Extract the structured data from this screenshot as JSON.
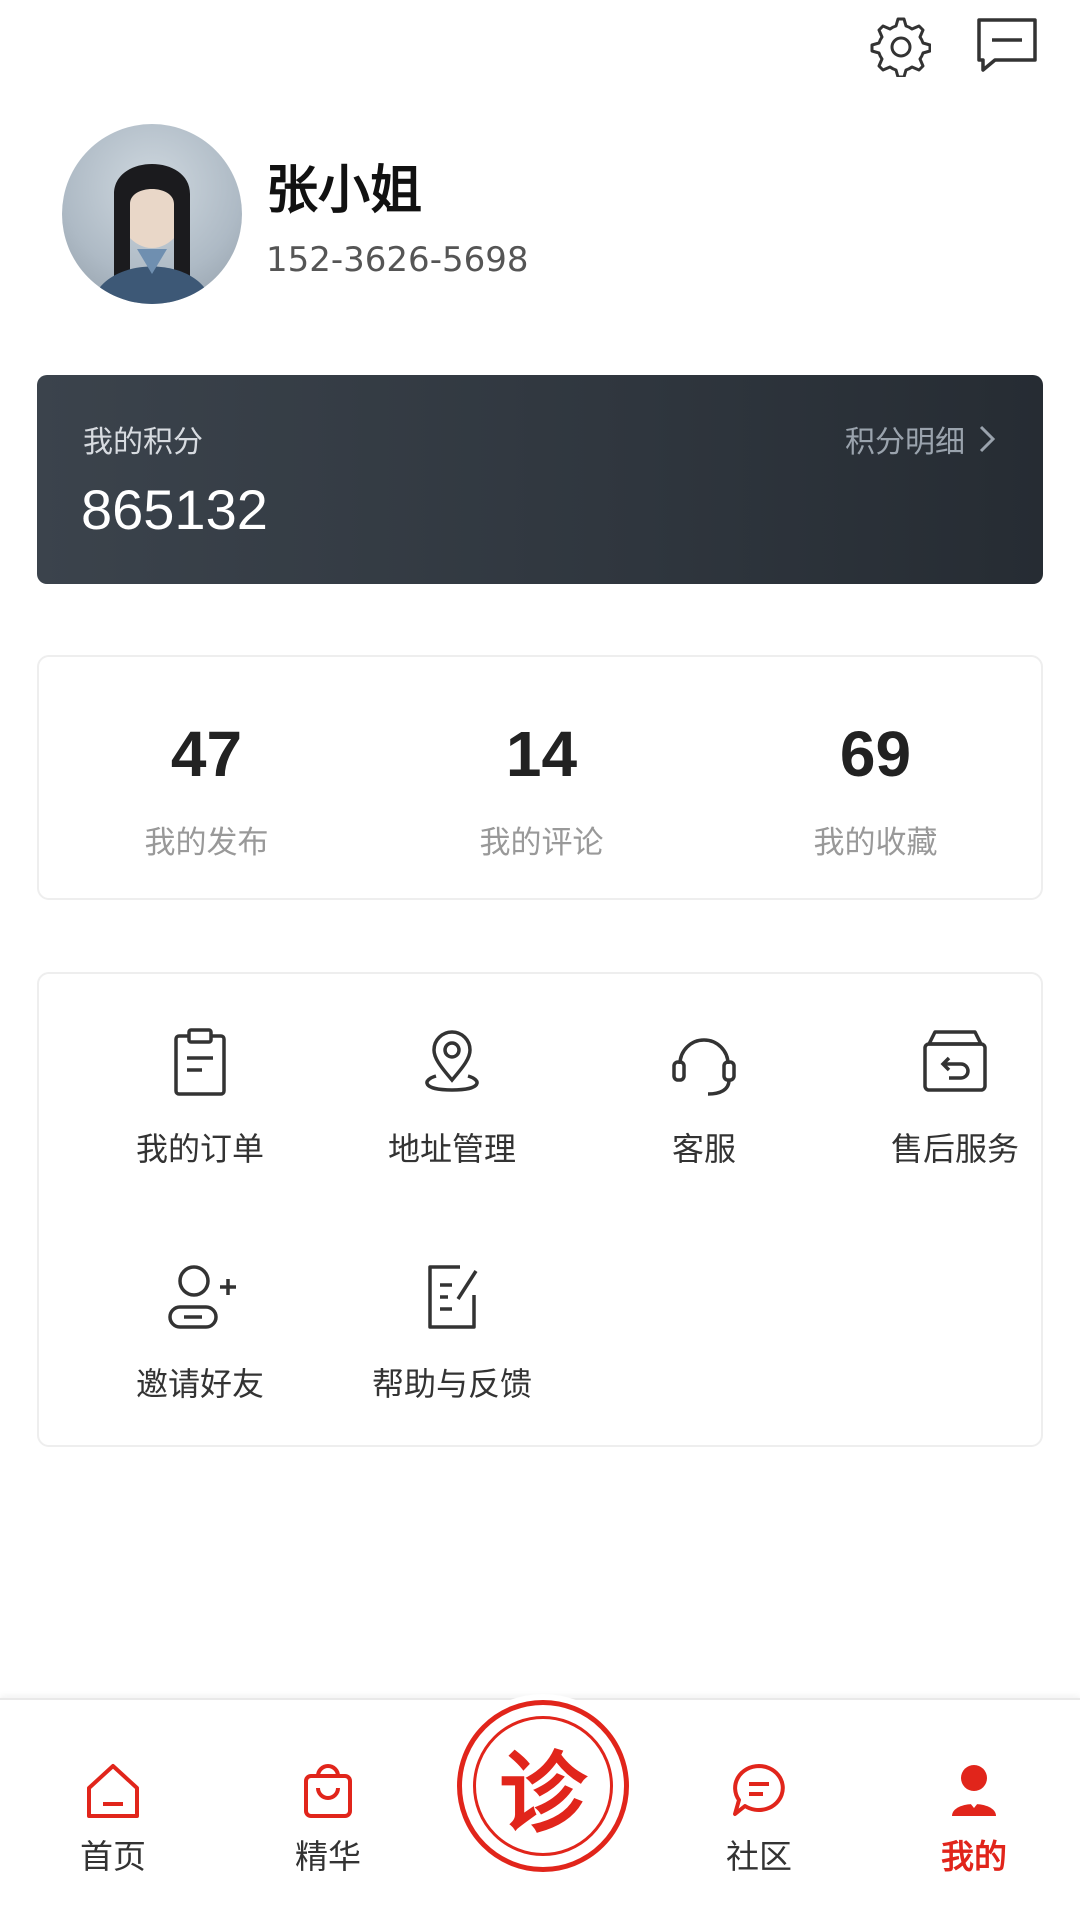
{
  "accent_color": "#e1251b",
  "header_icons": [
    "gear-icon",
    "message-icon"
  ],
  "profile": {
    "name": "张小姐",
    "phone": "152-3626-5698"
  },
  "points": {
    "label": "我的积分",
    "value": "865132",
    "detail_link": "积分明细"
  },
  "stats": [
    {
      "value": "47",
      "label": "我的发布"
    },
    {
      "value": "14",
      "label": "我的评论"
    },
    {
      "value": "69",
      "label": "我的收藏"
    }
  ],
  "services": [
    {
      "icon": "clipboard-icon",
      "label": "我的订单"
    },
    {
      "icon": "location-pin-icon",
      "label": "地址管理"
    },
    {
      "icon": "headset-icon",
      "label": "客服"
    },
    {
      "icon": "return-box-icon",
      "label": "售后服务"
    },
    {
      "icon": "add-user-icon",
      "label": "邀请好友"
    },
    {
      "icon": "edit-note-icon",
      "label": "帮助与反馈"
    }
  ],
  "bottom_nav": {
    "items": [
      {
        "icon": "home-icon",
        "label": "首页"
      },
      {
        "icon": "bag-icon",
        "label": "精华"
      },
      {
        "icon": "chat-bubble-icon",
        "label": "社区"
      },
      {
        "icon": "user-icon",
        "label": "我的",
        "active": true
      }
    ],
    "center_button_text": "诊"
  }
}
